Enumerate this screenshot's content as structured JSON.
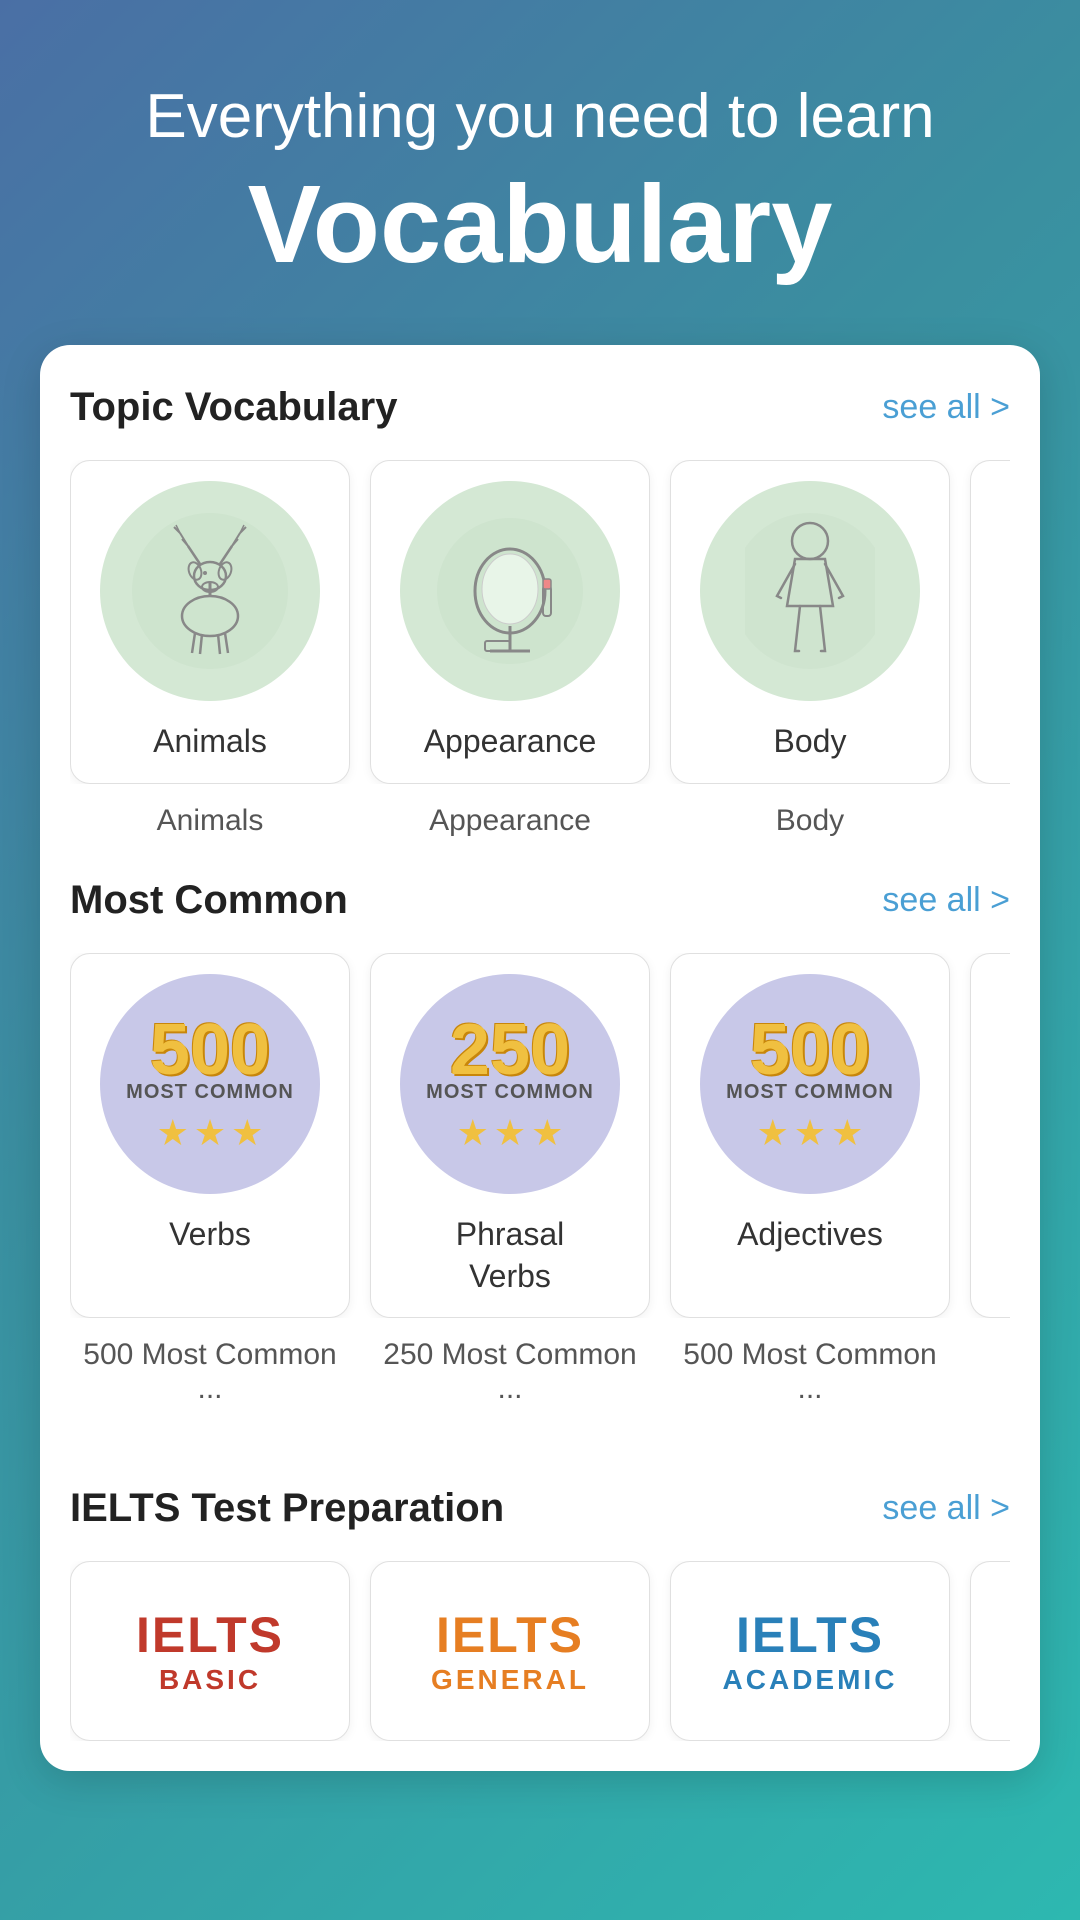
{
  "hero": {
    "subtitle": "Everything you need to learn",
    "title": "Vocabulary"
  },
  "topic_section": {
    "title": "Topic Vocabulary",
    "see_all": "see all >",
    "cards": [
      {
        "label": "Animals",
        "bottom_label": "Animals",
        "bg": "green"
      },
      {
        "label": "Appearance",
        "bottom_label": "Appearance",
        "bg": "green"
      },
      {
        "label": "Body",
        "bottom_label": "Body",
        "bg": "green"
      }
    ]
  },
  "common_section": {
    "title": "Most Common",
    "see_all": "see all >",
    "cards": [
      {
        "number": "500",
        "label": "Verbs",
        "bottom_label": "500 Most Common ...",
        "stars": 3
      },
      {
        "number": "250",
        "label": "Phrasal\nVerbs",
        "bottom_label": "250 Most Common ...",
        "stars": 3
      },
      {
        "number": "500",
        "label": "Adjectives",
        "bottom_label": "500 Most Common ...",
        "stars": 3
      }
    ]
  },
  "ielts_section": {
    "title": "IELTS Test Preparation",
    "see_all": "see all >",
    "cards": [
      {
        "main": "IELTS",
        "sub": "BASIC",
        "type": "basic"
      },
      {
        "main": "IELTS",
        "sub": "GENERAL",
        "type": "general"
      },
      {
        "main": "IELTS",
        "sub": "ACADEMIC",
        "type": "academic"
      }
    ]
  }
}
